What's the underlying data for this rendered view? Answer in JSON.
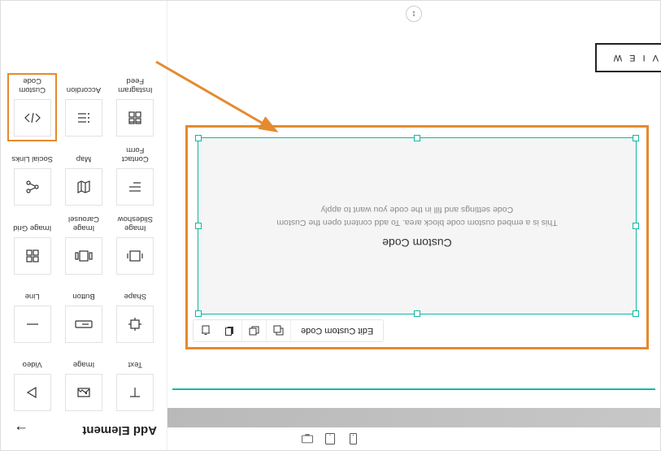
{
  "toolbar": {
    "devices": [
      "mobile",
      "tablet",
      "desktop"
    ]
  },
  "block": {
    "edit_label": "Edit Custom Code",
    "placeholder_title": "Custom Code",
    "placeholder_desc": "This is a embed custom code block area. To add content open the Custom Code settings and fill in the code you want to apply"
  },
  "view_button": "V I E W",
  "panel": {
    "title": "Add Element",
    "elements": [
      {
        "label": "Text",
        "icon": "text"
      },
      {
        "label": "Image",
        "icon": "image"
      },
      {
        "label": "Video",
        "icon": "video"
      },
      {
        "label": "Shape",
        "icon": "shape"
      },
      {
        "label": "Button",
        "icon": "button"
      },
      {
        "label": "Line",
        "icon": "line"
      },
      {
        "label": "Image Slideshow",
        "icon": "slideshow"
      },
      {
        "label": "Image Carousel",
        "icon": "carousel"
      },
      {
        "label": "Image Grid",
        "icon": "grid"
      },
      {
        "label": "Contact Form",
        "icon": "form"
      },
      {
        "label": "Map",
        "icon": "map"
      },
      {
        "label": "Social Links",
        "icon": "social"
      },
      {
        "label": "Instagram Feed",
        "icon": "insta"
      },
      {
        "label": "Accordion",
        "icon": "accordion"
      },
      {
        "label": "Custom Code",
        "icon": "code",
        "selected": true
      }
    ]
  }
}
